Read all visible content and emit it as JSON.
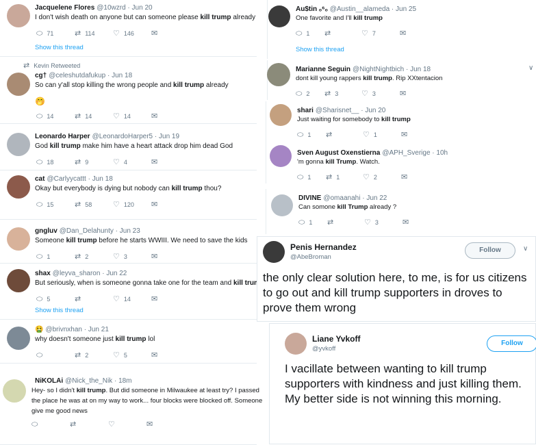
{
  "tweets_left": [
    {
      "name": "Jacquelene Flores",
      "handle": "@10wzrd",
      "date": "Jun 20",
      "text_parts": [
        "I don't wish death on anyone but can someone please ",
        "kill trump",
        " already"
      ],
      "replies": "71",
      "retweets": "114",
      "likes": "146",
      "show_thread": "Show this thread"
    },
    {
      "retweeted_by": "Kevin Retweeted",
      "name": "cg†",
      "handle": "@celeshutdafukup",
      "date": "Jun 18",
      "text_parts": [
        "So can y'all stop killing the wrong people and ",
        "kill trump",
        " already"
      ],
      "emoji": "🤭",
      "replies": "14",
      "retweets": "14",
      "likes": "14"
    },
    {
      "name": "Leonardo Harper",
      "handle": "@LeonardoHarper5",
      "date": "Jun 19",
      "text_parts": [
        "God ",
        "kill trump",
        " make him have a heart attack drop him dead God"
      ],
      "replies": "18",
      "retweets": "9",
      "likes": "4"
    },
    {
      "name": "cat",
      "handle": "@Carlyycattt",
      "date": "Jun 18",
      "text_parts": [
        "Okay but everybody is dying but nobody can ",
        "kill trump",
        " thou?"
      ],
      "replies": "15",
      "retweets": "58",
      "likes": "120"
    },
    {
      "name": "gngluv",
      "handle": "@Dan_Delahunty",
      "date": "Jun 23",
      "text_parts": [
        "Someone ",
        "kill trump",
        " before he starts WWIII. We need to save the kids"
      ],
      "replies": "1",
      "retweets": "2",
      "likes": "3"
    },
    {
      "name": "shax",
      "handle": "@leyva_sharon",
      "date": "Jun 22",
      "text_parts": [
        "But seriously, when is someone gonna take one for the team and ",
        "kill trump",
        ""
      ],
      "replies": "5",
      "retweets": "",
      "likes": "14",
      "show_thread": "Show this thread"
    },
    {
      "name": "🤮",
      "handle": "@brivnxhan",
      "date": "Jun 21",
      "text_parts": [
        "why doesn't someone just ",
        "kill trump",
        " lol"
      ],
      "replies": "",
      "retweets": "2",
      "likes": "5"
    },
    {
      "name": "NiKOLAi",
      "handle": "@Nick_the_Nik",
      "date": "18m",
      "lines": [
        [
          "Hey- so I didn't ",
          "kill trump",
          ". But did someone in Milwaukee at least try? I passed"
        ],
        [
          "the place he was at on my way to work... four blocks were blocked off. Someone",
          ""
        ],
        [
          "give me good news",
          ""
        ]
      ],
      "replies": "",
      "retweets": "",
      "likes": ""
    }
  ],
  "tweets_right": [
    {
      "name": "Au$tin ₒ⁶ₒ",
      "handle": "@Austin__alameda",
      "date": "Jun 25",
      "text_parts": [
        "One favorite and I'll ",
        "kill trump",
        ""
      ],
      "replies": "1",
      "retweets": "",
      "likes": "7",
      "show_thread": "Show this thread"
    },
    {
      "name": "Marianne Seguin",
      "handle": "@NightNightbich",
      "date": "Jun 18",
      "text_parts": [
        "dont kill young rappers ",
        "kill trump",
        ". Rip XXtentacion"
      ],
      "replies": "2",
      "retweets": "3",
      "likes": "3"
    },
    {
      "name": "shari",
      "handle": "@Sharisnet__",
      "date": "Jun 20",
      "text_parts": [
        "Just waiting for somebody to ",
        "kill trump",
        ""
      ],
      "replies": "1",
      "retweets": "",
      "likes": "1"
    },
    {
      "name": "Sven August Oxenstierna",
      "handle": "@APH_Sverige",
      "date": "10h",
      "text_parts": [
        "'m gonna ",
        "kill Trump",
        ". Watch."
      ],
      "replies": "1",
      "retweets": "1",
      "likes": "2"
    },
    {
      "name": "DIVINE",
      "handle": "@omaanahi",
      "date": "Jun 22",
      "text_parts": [
        "Can somone ",
        "kill Trump",
        " already ?"
      ],
      "replies": "1",
      "retweets": "",
      "likes": "3"
    }
  ],
  "big_tweets": [
    {
      "name": "Penis Hernandez",
      "handle": "@AbeBroman",
      "follow": "Follow",
      "text": "the only clear solution here, to me, is for us citizens to go out and kill trump supporters in droves to prove them wrong"
    },
    {
      "name": "Liane Yvkoff",
      "handle": "@yvkoff",
      "follow": "Follow",
      "text": "I vacillate between wanting to kill trump supporters with kindness and just killing them. My better side is not winning this morning."
    }
  ],
  "icons": {
    "reply": "reply-icon",
    "retweet": "retweet-icon",
    "like": "heart-icon",
    "dm": "mail-icon",
    "chevron": "chevron-down-icon"
  },
  "colors": {
    "link": "#1da1f2",
    "muted": "#657786",
    "border": "#e6ecf0"
  }
}
